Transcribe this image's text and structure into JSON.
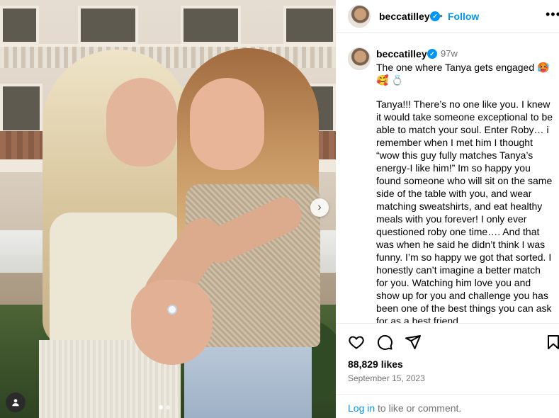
{
  "post": {
    "username": "beccatilley",
    "header_action": "Follow",
    "separator": "•",
    "time_ago": "97w",
    "caption_title": "The one where Tanya gets engaged 🥵 🥰 💍",
    "caption_body": "Tanya!!! There’s no one like you. I knew it would take someone exceptional to be able to match your soul. Enter Roby… i remember when I met him I thought “wow this guy fully matches Tanya’s energy-I like him!” Im so happy you found someone who will sit on the same side of the table with you, and wear matching sweatshirts, and eat healthy meals with you forever! I only ever questioned roby one time…. And that was when he said he didn’t think I was funny. I’m so happy we got that sorted. I honestly can’t imagine a better match for you. Watching him love you and show up for you and challenge you has been one of the best things you can ask for as a best friend",
    "likes": "88,829 likes",
    "date": "September 15, 2023",
    "login_link": "Log in",
    "login_rest": " to like or comment."
  },
  "icons": {
    "verified": "verified-badge-icon",
    "more": "more-options-icon",
    "like": "heart-icon",
    "comment": "comment-icon",
    "share": "share-icon",
    "save": "bookmark-icon",
    "next": "chevron-right-icon",
    "tag": "user-tag-icon"
  },
  "colors": {
    "accent": "#0095f6",
    "muted": "#737373"
  },
  "carousel": {
    "total_dots": 2,
    "active_dot": 1
  }
}
